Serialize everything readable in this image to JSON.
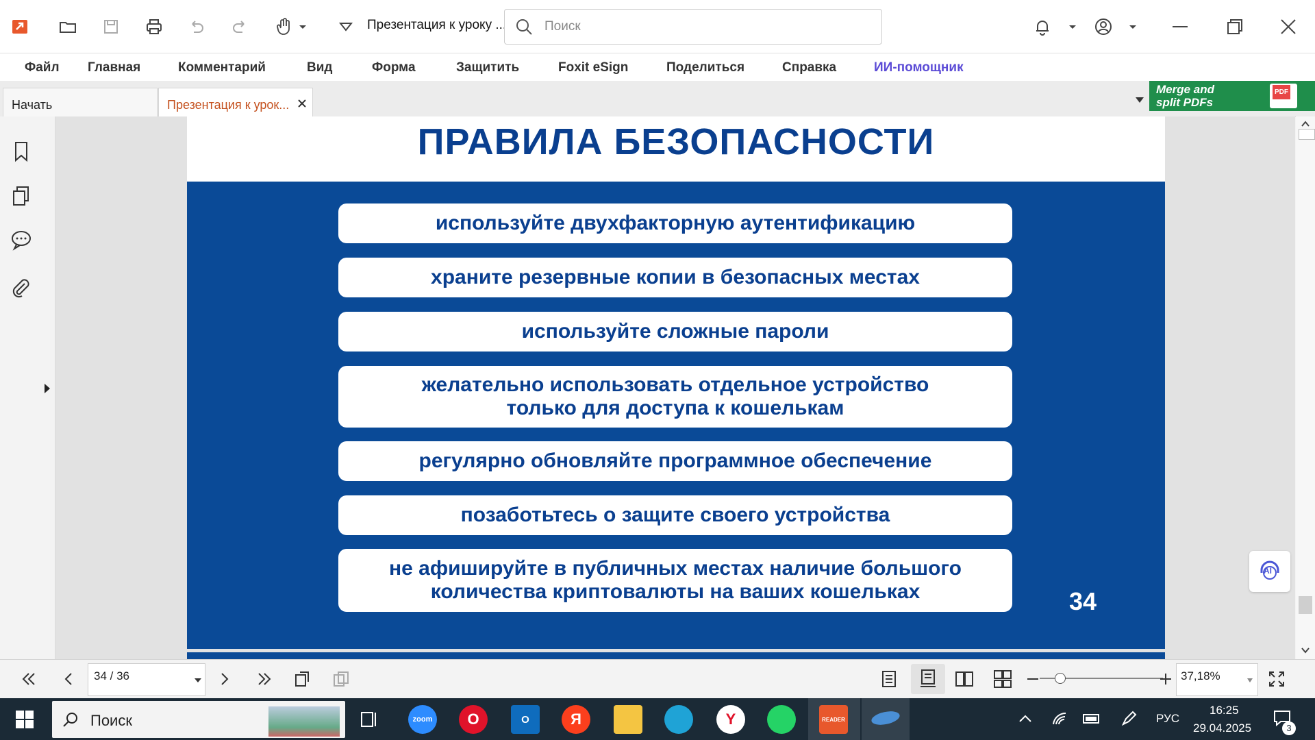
{
  "titlebar": {
    "doc_title": "Презентация к уроку ...",
    "search_placeholder": "Поиск"
  },
  "menu": [
    "Файл",
    "Главная",
    "Комментарий",
    "Вид",
    "Форма",
    "Защитить",
    "Foxit eSign",
    "Поделиться",
    "Справка",
    "ИИ-помощник"
  ],
  "tabs": {
    "home_label": "Начать",
    "doc_label": "Презентация к урок..."
  },
  "ad": {
    "line1": "Merge and",
    "line2": "split PDFs",
    "badge": "PDF"
  },
  "slide": {
    "title": "ПРАВИЛА БЕЗОПАСНОСТИ",
    "rules": [
      [
        "используйте двухфакторную аутентификацию"
      ],
      [
        "храните резервные копии в безопасных местах"
      ],
      [
        "используйте сложные пароли"
      ],
      [
        "желательно использовать отдельное устройство",
        "только для доступа к кошелькам"
      ],
      [
        "регулярно обновляйте программное обеспечение"
      ],
      [
        "позаботьтесь о защите своего устройства"
      ],
      [
        "не афишируйте в публичных местах наличие большого",
        "количества криптовалюты на ваших кошельках"
      ]
    ],
    "page_number": "34",
    "accent": "#0a4a97"
  },
  "status": {
    "page_indicator": "34 / 36",
    "zoom": "37,18%"
  },
  "ai_badge": "AI",
  "taskbar": {
    "search_label": "Поиск",
    "lang": "РУС",
    "time": "16:25",
    "date": "29.04.2025",
    "notifications": "3",
    "apps": [
      {
        "name": "zoom",
        "label": "zoom",
        "color": "#2d8cff"
      },
      {
        "name": "opera",
        "label": "O",
        "color": "#e0132a"
      },
      {
        "name": "outlook",
        "label": "O",
        "color": "#0f6cbd"
      },
      {
        "name": "yandex",
        "label": "Я",
        "color": "#fc3f1d"
      },
      {
        "name": "explorer",
        "label": "",
        "color": "#f4c542"
      },
      {
        "name": "edge",
        "label": "",
        "color": "#1fa3d6"
      },
      {
        "name": "yandex-browser",
        "label": "Y",
        "color": "#ffffff"
      },
      {
        "name": "whatsapp",
        "label": "",
        "color": "#25d366"
      },
      {
        "name": "foxit-reader",
        "label": "READER",
        "color": "#e8582c"
      }
    ]
  }
}
